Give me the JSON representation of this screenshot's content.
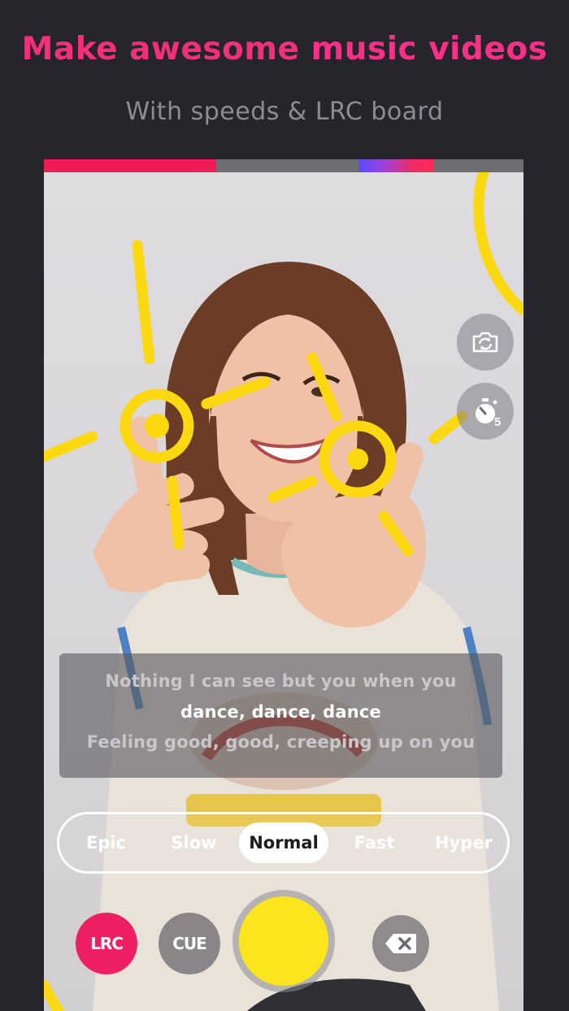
{
  "header": {
    "title_part1": "Make awesome ",
    "title_part2": "music videos",
    "subtitle": "With speeds & LRC board"
  },
  "camera": {
    "switch_camera_icon": "switch-camera-icon",
    "timer_icon": "stopwatch-icon",
    "timer_value": "5"
  },
  "lyrics": {
    "previous": "Nothing I can see but you when you",
    "current": "dance, dance, dance",
    "next": "Feeling good, good, creeping up on you"
  },
  "speed_selector": {
    "options": [
      "Epic",
      "Slow",
      "Normal",
      "Fast",
      "Hyper"
    ],
    "selected": "Normal"
  },
  "controls": {
    "lrc_label": "LRC",
    "cue_label": "CUE",
    "record_icon": "record-button",
    "delete_icon": "backspace-icon"
  },
  "colors": {
    "background": "#26252b",
    "accent_pink": "#ef1f63",
    "headline_pink": "#f0307a",
    "doodle_yellow": "#fbd80f",
    "record_yellow": "#fbe61e"
  }
}
